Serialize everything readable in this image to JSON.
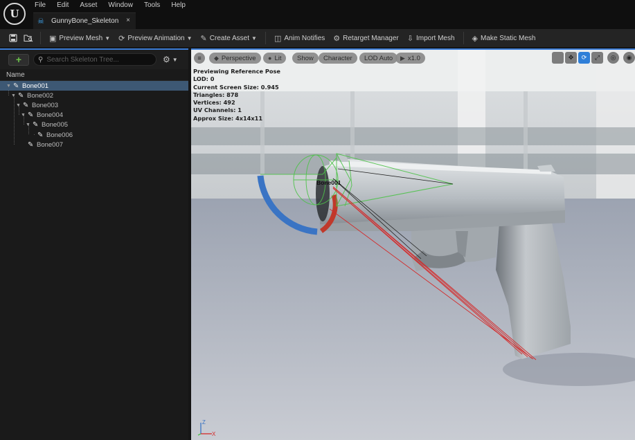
{
  "app": {
    "logo": "unreal-engine-logo",
    "menu": [
      "File",
      "Edit",
      "Asset",
      "Window",
      "Tools",
      "Help"
    ],
    "tab": {
      "label": "GunnyBone_Skeleton",
      "icon": "skeleton-icon",
      "close": "×"
    }
  },
  "toolbar": {
    "save_icon": "save-icon",
    "browse_icon": "browse-asset-icon",
    "buttons": [
      {
        "name": "preview-mesh",
        "label": "Preview Mesh",
        "icon": "mesh-icon",
        "dropdown": true
      },
      {
        "name": "preview-animation",
        "label": "Preview Animation",
        "icon": "animation-icon",
        "dropdown": true
      },
      {
        "name": "create-asset",
        "label": "Create Asset",
        "icon": "create-asset-icon",
        "dropdown": true
      },
      {
        "name": "anim-notifies",
        "label": "Anim Notifies",
        "icon": "notify-icon",
        "dropdown": false
      },
      {
        "name": "retarget-manager",
        "label": "Retarget Manager",
        "icon": "retarget-icon",
        "dropdown": false
      },
      {
        "name": "import-mesh",
        "label": "Import Mesh",
        "icon": "import-icon",
        "dropdown": false
      },
      {
        "name": "make-static-mesh",
        "label": "Make Static Mesh",
        "icon": "static-mesh-icon",
        "dropdown": false
      }
    ]
  },
  "skeleton_tree": {
    "add_label": "+",
    "search_placeholder": "Search Skeleton Tree...",
    "header": "Name",
    "bones": [
      {
        "name": "Bone001",
        "depth": 0,
        "expanded": true,
        "selected": true
      },
      {
        "name": "Bone002",
        "depth": 1,
        "expanded": true,
        "selected": false
      },
      {
        "name": "Bone003",
        "depth": 2,
        "expanded": true,
        "selected": false
      },
      {
        "name": "Bone004",
        "depth": 3,
        "expanded": true,
        "selected": false
      },
      {
        "name": "Bone005",
        "depth": 4,
        "expanded": true,
        "selected": false
      },
      {
        "name": "Bone006",
        "depth": 5,
        "expanded": false,
        "selected": false
      },
      {
        "name": "Bone007",
        "depth": 2,
        "expanded": false,
        "selected": false
      }
    ]
  },
  "viewport": {
    "buttons": {
      "perspective": "Perspective",
      "lit": "Lit",
      "show": "Show",
      "character": "Character",
      "lod": "LOD Auto",
      "speed": "x1.0"
    },
    "stats": [
      "Previewing Reference Pose",
      "LOD: 0",
      "Current Screen Size: 0.945",
      "Triangles: 878",
      "Vertices: 492",
      "UV Channels: 1",
      "Approx Size: 4x14x11"
    ],
    "selected_bone_label": "Bone001",
    "transform_modes": [
      "translate-icon",
      "rotate-icon",
      "scale-icon"
    ],
    "active_mode": "rotate-icon",
    "axis": {
      "z": "Z",
      "x": "X"
    },
    "colors": {
      "accent": "#2f7fd8",
      "selection": "#3d5874",
      "rotate_blue": "#3a74c4",
      "rotate_red": "#c0392b"
    }
  }
}
